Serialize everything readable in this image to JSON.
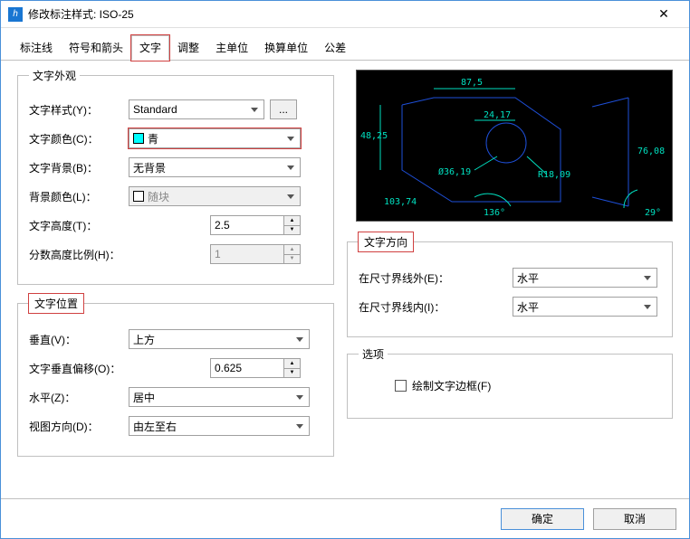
{
  "window": {
    "title": "修改标注样式: ISO-25"
  },
  "tabs": {
    "dim_lines": "标注线",
    "symbols_arrows": "符号和箭头",
    "text": "文字",
    "fit": "调整",
    "primary_units": "主单位",
    "alt_units": "换算单位",
    "tolerances": "公差"
  },
  "appearance": {
    "legend": "文字外观",
    "text_style_label": "文字样式(Y)：",
    "text_style_value": "Standard",
    "browse_label": "...",
    "text_color_label": "文字颜色(C)：",
    "text_color_value": "青",
    "text_color_swatch": "#00ffff",
    "text_bg_label": "文字背景(B)：",
    "text_bg_value": "无背景",
    "bg_color_label": "背景颜色(L)：",
    "bg_color_value": "随块",
    "text_height_label": "文字高度(T)：",
    "text_height_value": "2.5",
    "frac_height_label": "分数高度比例(H)：",
    "frac_height_value": "1"
  },
  "placement": {
    "legend": "文字位置",
    "vertical_label": "垂直(V)：",
    "vertical_value": "上方",
    "offset_label": "文字垂直偏移(O)：",
    "offset_value": "0.625",
    "horizontal_label": "水平(Z)：",
    "horizontal_value": "居中",
    "view_dir_label": "视图方向(D)：",
    "view_dir_value": "由左至右"
  },
  "direction": {
    "legend": "文字方向",
    "outside_label": "在尺寸界线外(E)：",
    "outside_value": "水平",
    "inside_label": "在尺寸界线内(I)：",
    "inside_value": "水平"
  },
  "options": {
    "legend": "选项",
    "frame_label": "绘制文字边框(F)"
  },
  "footer": {
    "ok": "确定",
    "cancel": "取消"
  },
  "preview": {
    "dim_top": "87,5",
    "dim_left": "48,25",
    "dim_short": "24,17",
    "dim_right": "76,08",
    "diameter": "Ø36,19",
    "radius": "R18,09",
    "ordinate": "103,74",
    "angle1": "136°",
    "angle2": "29°"
  }
}
